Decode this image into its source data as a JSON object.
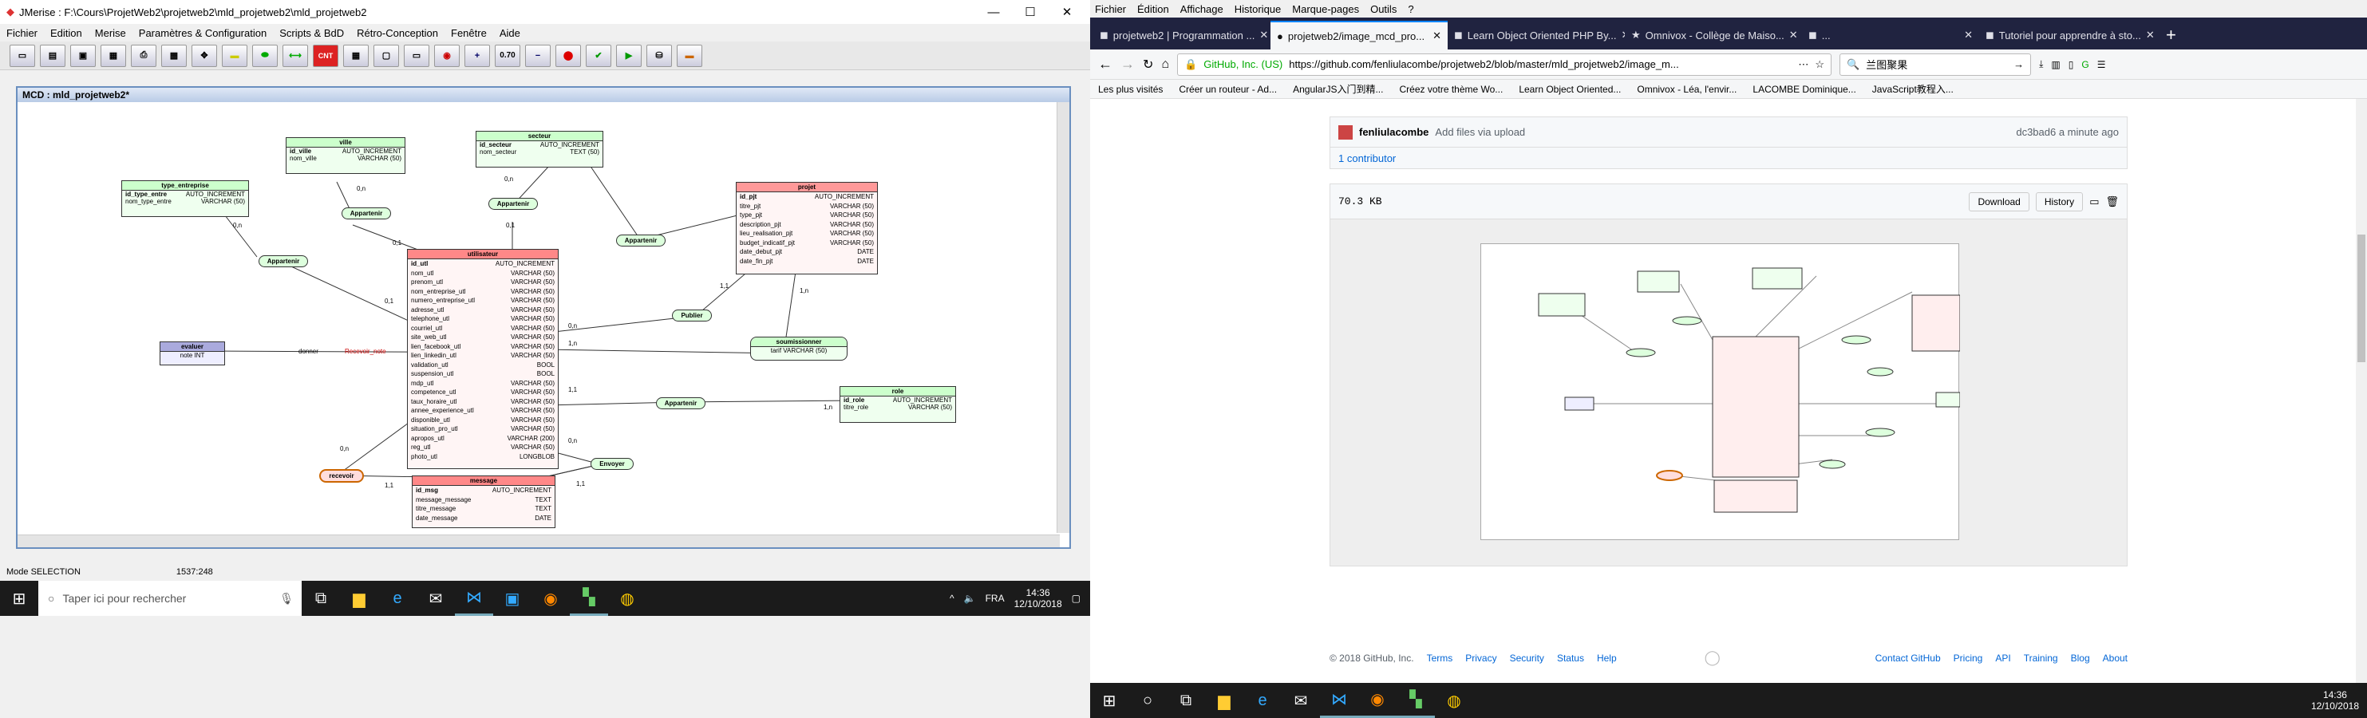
{
  "jmerise": {
    "title": "JMerise : F:\\Cours\\ProjetWeb2\\projetweb2\\mld_projetweb2\\mld_projetweb2",
    "menu": [
      "Fichier",
      "Edition",
      "Merise",
      "Paramètres & Configuration",
      "Scripts & BdD",
      "Rétro-Conception",
      "Fenêtre",
      "Aide"
    ],
    "toolbar_zoom": "0.70",
    "toolbar_cnt": "CNT",
    "mcd_title": "MCD : mld_projetweb2*",
    "status_mode": "Mode SELECTION",
    "status_coords": "1537:248",
    "entities": {
      "type_entreprise": {
        "name": "type_entreprise",
        "rows": [
          [
            "id_type_entre",
            "AUTO_INCREMENT"
          ],
          [
            "nom_type_entre",
            "VARCHAR (50)"
          ]
        ]
      },
      "ville": {
        "name": "ville",
        "rows": [
          [
            "id_ville",
            "AUTO_INCREMENT"
          ],
          [
            "nom_ville",
            "VARCHAR (50)"
          ]
        ]
      },
      "secteur": {
        "name": "secteur",
        "rows": [
          [
            "id_secteur",
            "AUTO_INCREMENT"
          ],
          [
            "nom_secteur",
            "TEXT (50)"
          ]
        ]
      },
      "projet": {
        "name": "projet",
        "rows": [
          [
            "id_pjt",
            "AUTO_INCREMENT"
          ],
          [
            "titre_pjt",
            "VARCHAR (50)"
          ],
          [
            "type_pjt",
            "VARCHAR (50)"
          ],
          [
            "description_pjt",
            "VARCHAR (50)"
          ],
          [
            "lieu_realisation_pjt",
            "VARCHAR (50)"
          ],
          [
            "budget_indicatif_pjt",
            "VARCHAR (50)"
          ],
          [
            "date_debut_pjt",
            "DATE"
          ],
          [
            "date_fin_pjt",
            "DATE"
          ]
        ]
      },
      "utilisateur": {
        "name": "utilisateur",
        "rows": [
          [
            "id_utl",
            "AUTO_INCREMENT"
          ],
          [
            "nom_utl",
            "VARCHAR (50)"
          ],
          [
            "prenom_utl",
            "VARCHAR (50)"
          ],
          [
            "nom_entreprise_utl",
            "VARCHAR (50)"
          ],
          [
            "numero_entreprise_utl",
            "VARCHAR (50)"
          ],
          [
            "adresse_utl",
            "VARCHAR (50)"
          ],
          [
            "telephone_utl",
            "VARCHAR (50)"
          ],
          [
            "courriel_utl",
            "VARCHAR (50)"
          ],
          [
            "site_web_utl",
            "VARCHAR (50)"
          ],
          [
            "lien_facebook_utl",
            "VARCHAR (50)"
          ],
          [
            "lien_linkedin_utl",
            "VARCHAR (50)"
          ],
          [
            "validation_utl",
            "BOOL"
          ],
          [
            "suspension_utl",
            "BOOL"
          ],
          [
            "mdp_utl",
            "VARCHAR (50)"
          ],
          [
            "competence_utl",
            "VARCHAR (50)"
          ],
          [
            "taux_horaire_utl",
            "VARCHAR (50)"
          ],
          [
            "annee_experience_utl",
            "VARCHAR (50)"
          ],
          [
            "disponible_utl",
            "VARCHAR (50)"
          ],
          [
            "situation_pro_utl",
            "VARCHAR (50)"
          ],
          [
            "apropos_utl",
            "VARCHAR (200)"
          ],
          [
            "reg_utl",
            "VARCHAR (50)"
          ],
          [
            "photo_utl",
            "LONGBLOB"
          ]
        ]
      },
      "evaluer": {
        "name": "evaluer",
        "rows": [
          [
            "note",
            "INT"
          ]
        ]
      },
      "role": {
        "name": "role",
        "rows": [
          [
            "id_role",
            "AUTO_INCREMENT"
          ],
          [
            "titre_role",
            "VARCHAR (50)"
          ]
        ]
      },
      "message": {
        "name": "message",
        "rows": [
          [
            "id_msg",
            "AUTO_INCREMENT"
          ],
          [
            "message_message",
            "TEXT"
          ],
          [
            "titre_message",
            "TEXT"
          ],
          [
            "date_message",
            "DATE"
          ]
        ]
      },
      "soumissionner": {
        "name": "soumissionner",
        "rows": [
          [
            "tarif",
            "VARCHAR (50)"
          ]
        ]
      }
    },
    "relations": {
      "appartenir1": "Appartenir",
      "appartenir2": "Appartenir",
      "appartenir3": "Appartenir",
      "appartenir4": "Appartenir",
      "appartenir5": "Appartenir",
      "publier": "Publier",
      "envoyer": "Envoyer",
      "recevoir": "recevoir"
    },
    "card": {
      "c1": "0,n",
      "c2": "0,n",
      "c3": "0,n",
      "c4": "0,1",
      "c5": "0,1",
      "c6": "0,1",
      "c7": "1,1",
      "c8": "1,n",
      "c9": "0,n",
      "c10": "1,n",
      "c11": "1,1",
      "c12": "1,n",
      "c13": "0,n",
      "c14": "1,1",
      "c15": "1,1",
      "c16": "0,n"
    },
    "donner_label": "donner",
    "recevoir_label": "Recevoir_note"
  },
  "taskbar_left": {
    "search_placeholder": "Taper ici pour rechercher",
    "lang": "FRA",
    "time": "14:36",
    "date": "12/10/2018"
  },
  "firefox": {
    "menu": [
      "Fichier",
      "Édition",
      "Affichage",
      "Historique",
      "Marque-pages",
      "Outils",
      "?"
    ],
    "tabs": [
      "projetweb2 | Programmation ...",
      "projetweb2/image_mcd_pro...",
      "Learn Object Oriented PHP By...",
      "Omnivox - Collège de Maiso...",
      "...",
      "Tutoriel pour apprendre à sto..."
    ],
    "url_identity": "GitHub, Inc. (US)",
    "url": "https://github.com/fenliulacombe/projetweb2/blob/master/mld_projetweb2/image_m...",
    "search_value": "兰图聚果",
    "bookmarks": [
      "Les plus visités",
      "Créer un routeur - Ad...",
      "AngularJS入门到精...",
      "Créez votre thème Wo...",
      "Learn Object Oriented...",
      "Omnivox - Léa, l'envir...",
      "LACOMBE Dominique...",
      "JavaScript教程入..."
    ],
    "commit_author": "fenliulacombe",
    "commit_msg": "Add files via upload",
    "commit_meta": "dc3bad6 a minute ago",
    "contributors": "1 contributor",
    "file_size": "70.3 KB",
    "btn_download": "Download",
    "btn_history": "History",
    "footer_copy": "© 2018 GitHub, Inc.",
    "footer_left": [
      "Terms",
      "Privacy",
      "Security",
      "Status",
      "Help"
    ],
    "footer_right": [
      "Contact GitHub",
      "Pricing",
      "API",
      "Training",
      "Blog",
      "About"
    ]
  },
  "taskbar_right": {
    "time": "14:36",
    "date": "12/10/2018"
  }
}
